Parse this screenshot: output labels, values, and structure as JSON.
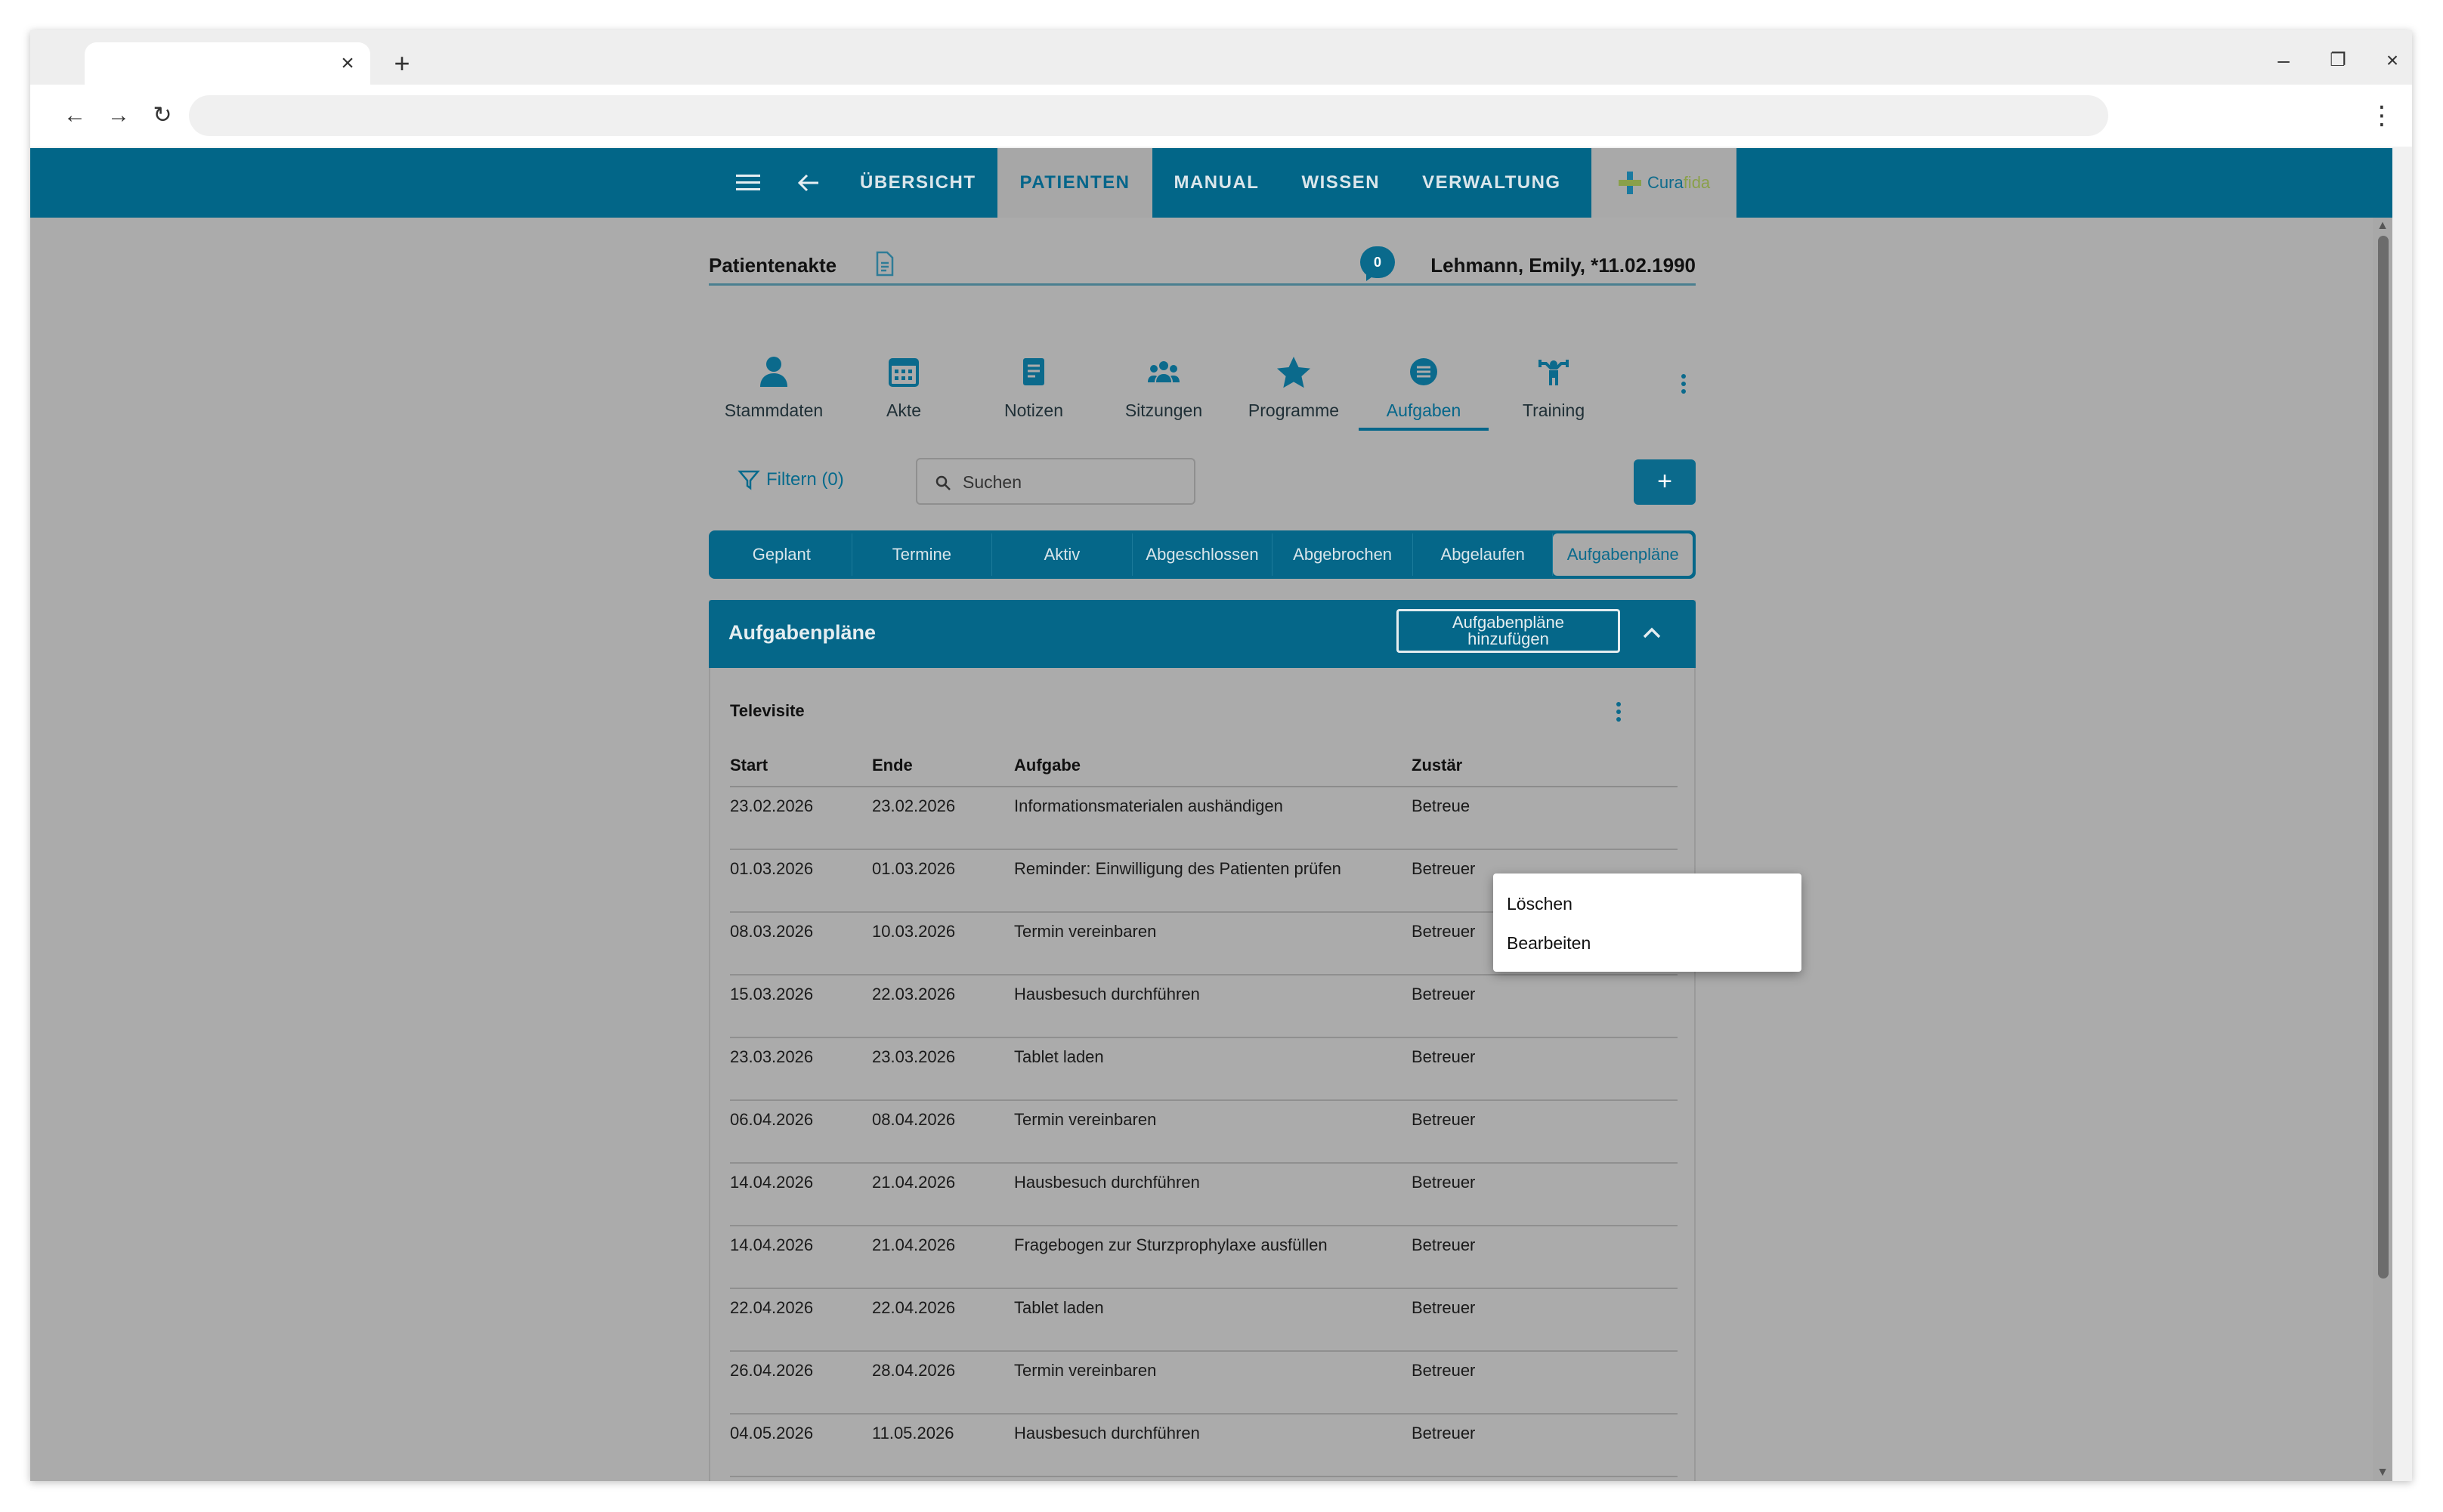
{
  "browser": {
    "tab_close": "×",
    "new_tab": "+",
    "minimize": "–",
    "restore": "❐",
    "close": "×",
    "back": "←",
    "forward": "→",
    "reload": "↻",
    "menu": "⋮"
  },
  "nav": {
    "items": [
      {
        "label": "ÜBERSICHT",
        "active": false
      },
      {
        "label": "PATIENTEN",
        "active": true
      },
      {
        "label": "MANUAL",
        "active": false
      },
      {
        "label": "WISSEN",
        "active": false
      },
      {
        "label": "VERWALTUNG",
        "active": false
      }
    ],
    "logo": {
      "part1": "Cura",
      "part2": "fida"
    }
  },
  "record": {
    "title": "Patientenakte",
    "message_count": "0",
    "patient": "Lehmann, Emily, *11.02.1990"
  },
  "subtabs": [
    {
      "label": "Stammdaten",
      "icon": "person-icon"
    },
    {
      "label": "Akte",
      "icon": "calendar-icon"
    },
    {
      "label": "Notizen",
      "icon": "note-icon"
    },
    {
      "label": "Sitzungen",
      "icon": "group-icon"
    },
    {
      "label": "Programme",
      "icon": "star-icon"
    },
    {
      "label": "Aufgaben",
      "icon": "list-icon",
      "active": true
    },
    {
      "label": "Training",
      "icon": "training-icon"
    }
  ],
  "filter": {
    "label": "Filtern (0)"
  },
  "search": {
    "placeholder": "Suchen"
  },
  "add_button": "+",
  "status_tabs": [
    "Geplant",
    "Termine",
    "Aktiv",
    "Abgeschlossen",
    "Abgebrochen",
    "Abgelaufen",
    "Aufgabenpläne"
  ],
  "status_active": "Aufgabenpläne",
  "panel": {
    "title": "Aufgabenpläne",
    "add_label_line1": "Aufgabenpläne",
    "add_label_line2": "hinzufügen",
    "plan_name": "Televisite"
  },
  "table": {
    "headers": [
      "Start",
      "Ende",
      "Aufgabe",
      "Zustär"
    ],
    "rows": [
      [
        "23.02.2026",
        "23.02.2026",
        "Informationsmaterialen aushändigen",
        "Betreue"
      ],
      [
        "01.03.2026",
        "01.03.2026",
        "Reminder: Einwilligung des Patienten prüfen",
        "Betreuer"
      ],
      [
        "08.03.2026",
        "10.03.2026",
        "Termin vereinbaren",
        "Betreuer"
      ],
      [
        "15.03.2026",
        "22.03.2026",
        "Hausbesuch durchführen",
        "Betreuer"
      ],
      [
        "23.03.2026",
        "23.03.2026",
        "Tablet laden",
        "Betreuer"
      ],
      [
        "06.04.2026",
        "08.04.2026",
        "Termin vereinbaren",
        "Betreuer"
      ],
      [
        "14.04.2026",
        "21.04.2026",
        "Hausbesuch durchführen",
        "Betreuer"
      ],
      [
        "14.04.2026",
        "21.04.2026",
        "Fragebogen zur Sturzprophylaxe ausfüllen",
        "Betreuer"
      ],
      [
        "22.04.2026",
        "22.04.2026",
        "Tablet laden",
        "Betreuer"
      ],
      [
        "26.04.2026",
        "28.04.2026",
        "Termin vereinbaren",
        "Betreuer"
      ],
      [
        "04.05.2026",
        "11.05.2026",
        "Hausbesuch durchführen",
        "Betreuer"
      ]
    ]
  },
  "context_menu": [
    "Löschen",
    "Bearbeiten"
  ],
  "colors": {
    "primary": "#056789",
    "overlay": "#ababab",
    "accent_green": "#8aa04a"
  }
}
